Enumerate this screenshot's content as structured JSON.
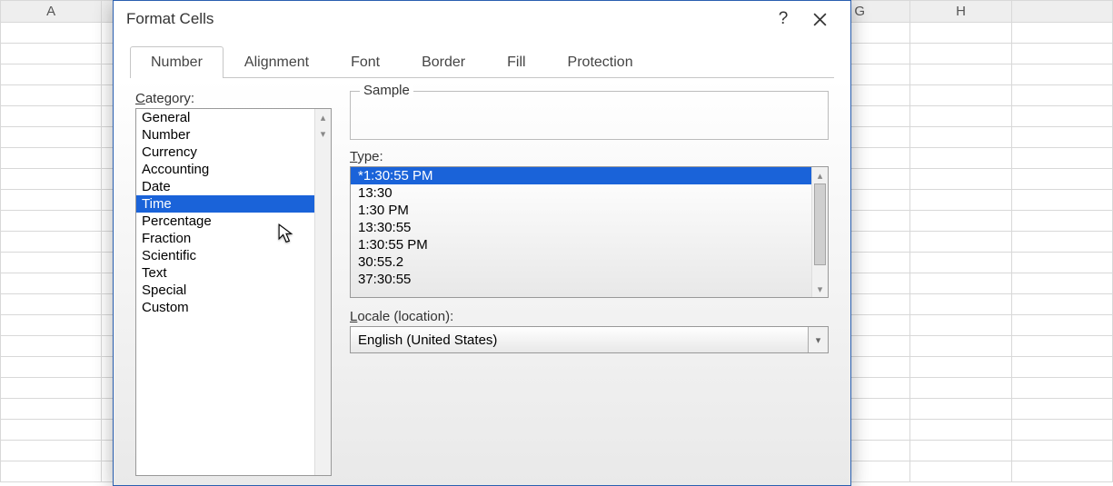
{
  "spreadsheet": {
    "columns": [
      "A",
      "",
      "",
      "",
      "",
      "",
      "",
      "",
      "G",
      "H",
      ""
    ]
  },
  "dialog": {
    "title": "Format Cells",
    "tabs": [
      "Number",
      "Alignment",
      "Font",
      "Border",
      "Fill",
      "Protection"
    ],
    "active_tab": 0,
    "category_label": "Category:",
    "categories": [
      "General",
      "Number",
      "Currency",
      "Accounting",
      "Date",
      "Time",
      "Percentage",
      "Fraction",
      "Scientific",
      "Text",
      "Special",
      "Custom"
    ],
    "selected_category": 5,
    "sample_label": "Sample",
    "sample_value": "",
    "type_label": "Type:",
    "types": [
      "*1:30:55 PM",
      "13:30",
      "1:30 PM",
      "13:30:55",
      "1:30:55 PM",
      "30:55.2",
      "37:30:55"
    ],
    "selected_type": 0,
    "locale_label": "Locale (location):",
    "locale_value": "English (United States)"
  }
}
